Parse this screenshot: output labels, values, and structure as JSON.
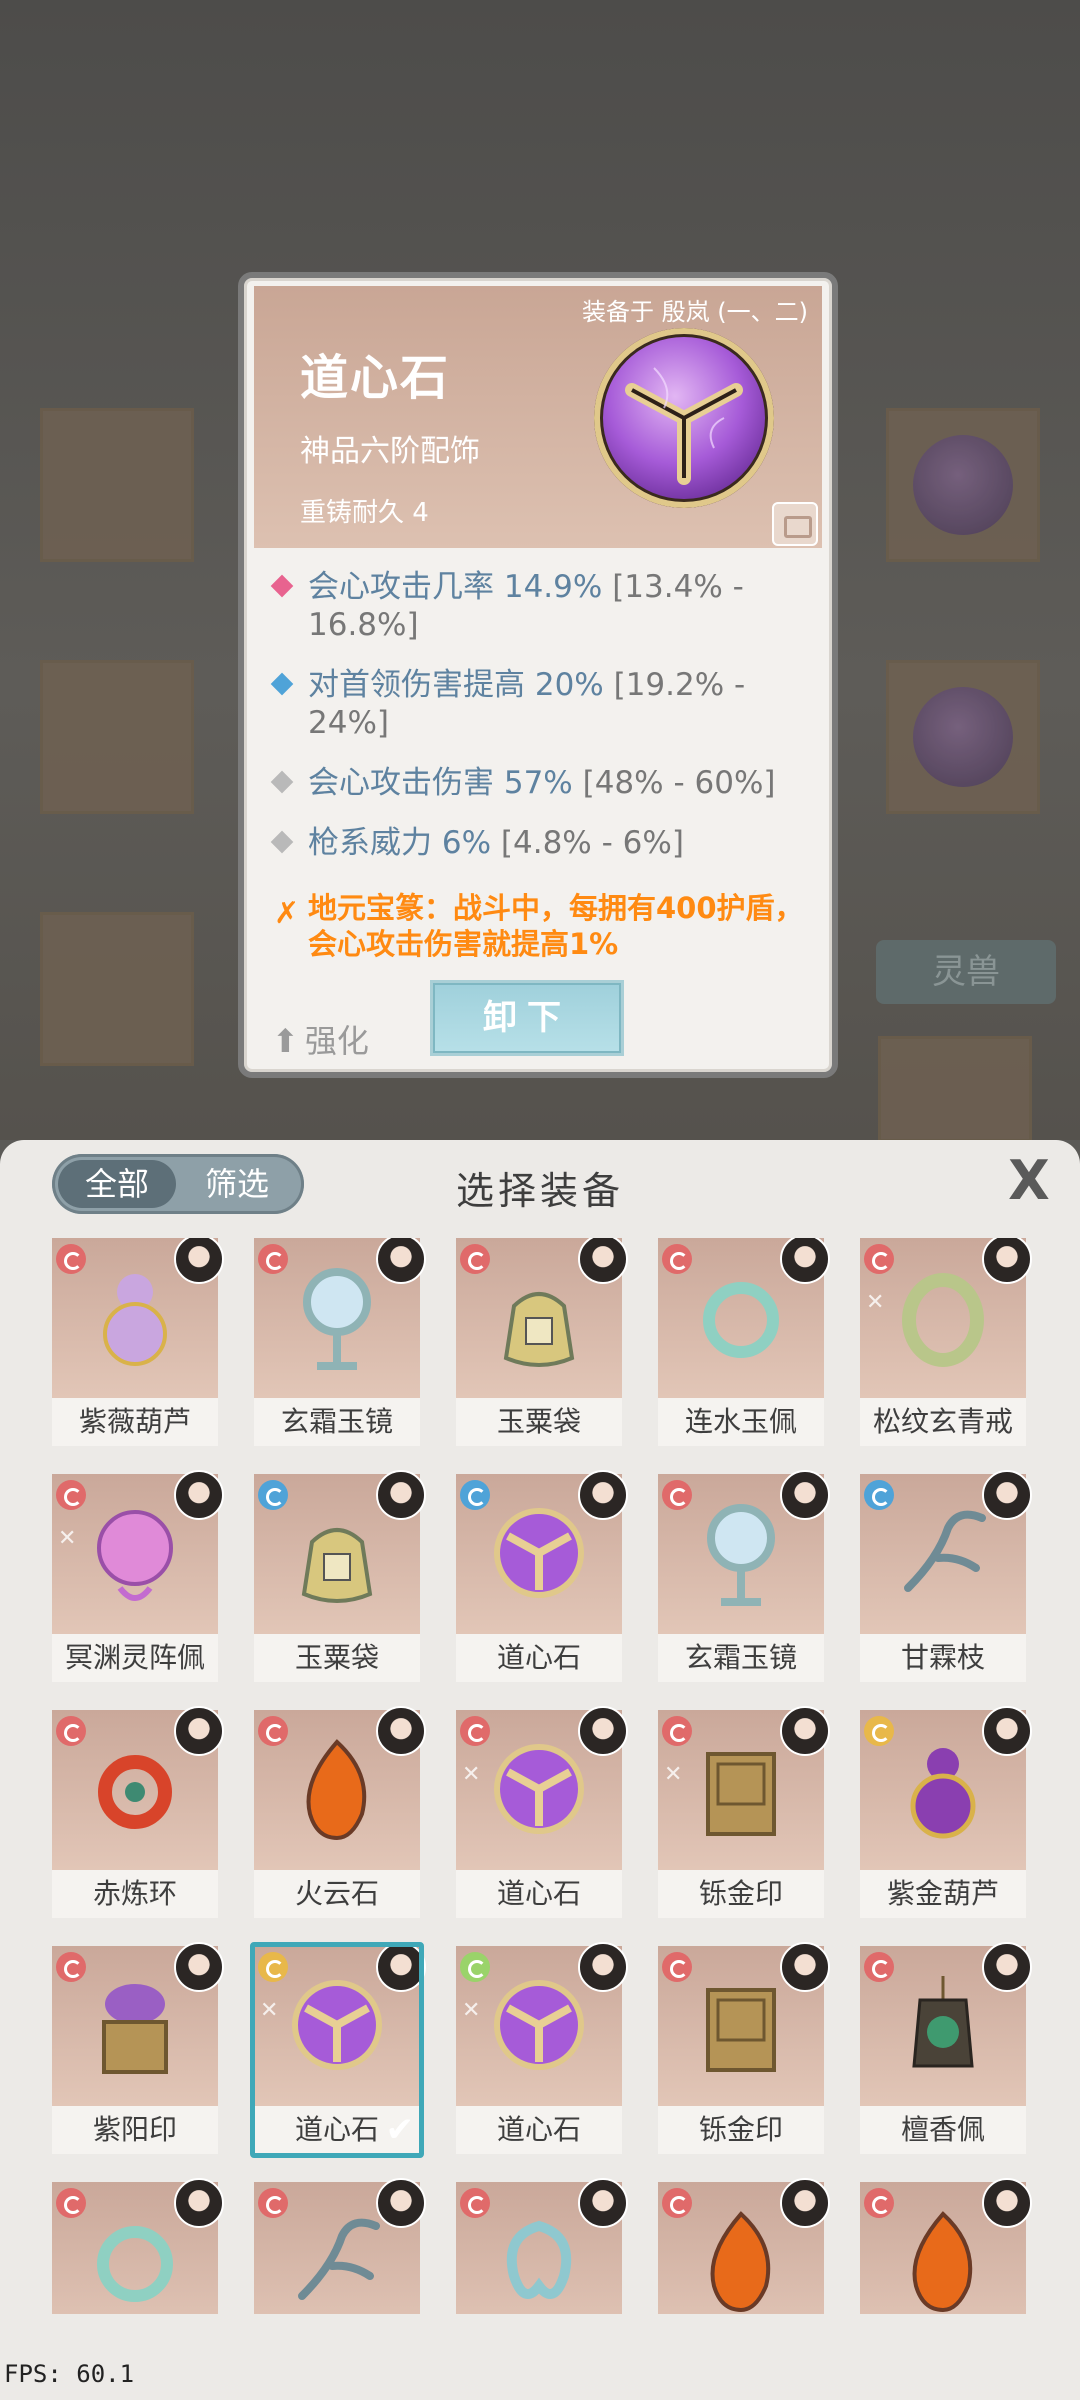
{
  "card": {
    "equipped_on": "装备于 殷岚 (一、二)",
    "name": "道心石",
    "grade": "神品六阶配饰",
    "recast": "重铸耐久 4",
    "stats": [
      {
        "main": "会心攻击几率 14.9%",
        "range": " [13.4% - 16.8%]",
        "color": "#e8638f"
      },
      {
        "main": "对首领伤害提高 20%",
        "range": " [19.2% - 24%]",
        "color": "#4fa3d8"
      },
      {
        "main": "会心攻击伤害 57%",
        "range": " [48% - 60%]",
        "color": "#b9b9b9"
      },
      {
        "main": "枪系威力 6%",
        "range": " [4.8% - 6%]",
        "color": "#b9b9b9"
      }
    ],
    "special": "地元宝篆：战斗中，每拥有400护盾，会心攻击伤害就提高1%",
    "upgrade_label": "强化",
    "unequip_label": "卸下"
  },
  "bg": {
    "beast_tab": "灵兽"
  },
  "panel": {
    "filter_all": "全部",
    "filter_screen": "筛选",
    "title": "选择装备",
    "close": "X"
  },
  "items": [
    {
      "name": "紫薇葫芦",
      "art": "gourd-purple",
      "q": "#e06a6a",
      "lock": false
    },
    {
      "name": "玄霜玉镜",
      "art": "mirror",
      "q": "#e06a6a",
      "lock": false
    },
    {
      "name": "玉粟袋",
      "art": "bag",
      "q": "#e06a6a",
      "lock": false
    },
    {
      "name": "连水玉佩",
      "art": "ring-jade",
      "q": "#e06a6a",
      "lock": false
    },
    {
      "name": "松纹玄青戒",
      "art": "ring-green",
      "q": "#e06a6a",
      "lock": true
    },
    {
      "name": "冥渊灵阵佩",
      "art": "array",
      "q": "#e06a6a",
      "lock": true
    },
    {
      "name": "玉粟袋",
      "art": "bag",
      "q": "#4fa3d8",
      "lock": false
    },
    {
      "name": "道心石",
      "art": "orb",
      "q": "#4fa3d8",
      "lock": false
    },
    {
      "name": "玄霜玉镜",
      "art": "mirror",
      "q": "#e06a6a",
      "lock": false
    },
    {
      "name": "甘霖枝",
      "art": "branch",
      "q": "#4fa3d8",
      "lock": false
    },
    {
      "name": "赤炼环",
      "art": "ring-red",
      "q": "#e06a6a",
      "lock": false
    },
    {
      "name": "火云石",
      "art": "fire",
      "q": "#e06a6a",
      "lock": false
    },
    {
      "name": "道心石",
      "art": "orb",
      "q": "#e06a6a",
      "lock": true
    },
    {
      "name": "铄金印",
      "art": "seal",
      "q": "#e06a6a",
      "lock": true
    },
    {
      "name": "紫金葫芦",
      "art": "gourd-gold",
      "q": "#e8b84a",
      "lock": false
    },
    {
      "name": "紫阳印",
      "art": "seal-purple",
      "q": "#e06a6a",
      "lock": false
    },
    {
      "name": "道心石",
      "art": "orb",
      "q": "#e8b84a",
      "lock": true,
      "selected": true
    },
    {
      "name": "道心石",
      "art": "orb",
      "q": "#9ad36a",
      "lock": true
    },
    {
      "name": "铄金印",
      "art": "seal",
      "q": "#e06a6a",
      "lock": false
    },
    {
      "name": "檀香佩",
      "art": "pendant",
      "q": "#e06a6a",
      "lock": false
    },
    {
      "name": "",
      "art": "ring-jade",
      "q": "#e06a6a",
      "lock": false
    },
    {
      "name": "",
      "art": "branch",
      "q": "#e06a6a",
      "lock": false
    },
    {
      "name": "",
      "art": "jade-knot",
      "q": "#e06a6a",
      "lock": false
    },
    {
      "name": "",
      "art": "fire",
      "q": "#e06a6a",
      "lock": false
    },
    {
      "name": "",
      "art": "fire",
      "q": "#e06a6a",
      "lock": false
    }
  ],
  "fps": "FPS: 60.1"
}
